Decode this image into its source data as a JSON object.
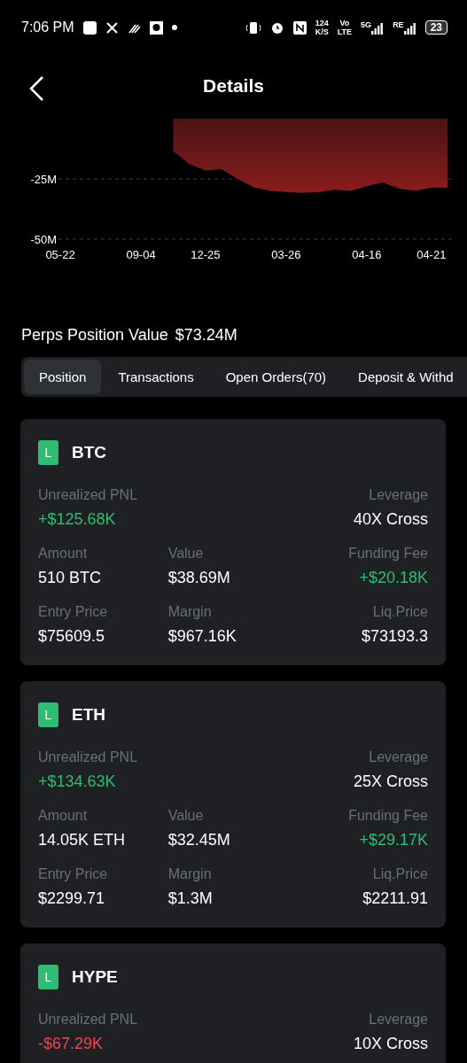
{
  "status_bar": {
    "time": "7:06 PM",
    "speed_value": "124",
    "speed_unit": "K/S",
    "volte_top": "Vo",
    "volte_bottom": "LTE",
    "network": "5G",
    "roaming": "RE",
    "battery": "23"
  },
  "header": {
    "title": "Details"
  },
  "chart": {
    "chart_data": {
      "type": "area",
      "categories": [
        "05-22",
        null,
        null,
        null,
        null,
        "09-04",
        null,
        null,
        null,
        "12-25",
        null,
        null,
        null,
        null,
        "03-26",
        null,
        null,
        null,
        null,
        "04-16",
        null,
        null,
        null,
        "04-21",
        null
      ],
      "series": [
        {
          "color": "#8a1c1c",
          "values": [
            null,
            null,
            null,
            null,
            null,
            null,
            null,
            -13.5,
            -18.8,
            -21.5,
            -21,
            -25,
            -28.5,
            -30,
            -30.4,
            -30.8,
            -30.5,
            -29.5,
            -30,
            -28,
            -26.5,
            -29,
            -30,
            -28.6,
            -28.7
          ]
        }
      ],
      "ylim": [
        -50,
        0
      ],
      "yticks": [
        {
          "value": -25,
          "label": "-25M"
        },
        {
          "value": -50,
          "label": "-50M"
        }
      ]
    }
  },
  "summary": {
    "label": "Perps Position Value",
    "value": "$73.24M"
  },
  "tabs": [
    {
      "label": "Position",
      "selected": true
    },
    {
      "label": "Transactions",
      "selected": false
    },
    {
      "label": "Open Orders(70)",
      "selected": false
    },
    {
      "label": "Deposit & Withd",
      "selected": false
    }
  ],
  "positions": [
    {
      "side": "L",
      "symbol": "BTC",
      "rows": [
        [
          {
            "label": "Unrealized PNL",
            "value": "+$125.68K",
            "kind": "gain"
          },
          null,
          {
            "label": "Leverage",
            "value": "40X Cross",
            "kind": "plain"
          }
        ],
        [
          {
            "label": "Amount",
            "value": "510 BTC",
            "kind": "plain"
          },
          {
            "label": "Value",
            "value": "$38.69M",
            "kind": "plain"
          },
          {
            "label": "Funding Fee",
            "value": "+$20.18K",
            "kind": "gain"
          }
        ],
        [
          {
            "label": "Entry Price",
            "value": "$75609.5",
            "kind": "plain"
          },
          {
            "label": "Margin",
            "value": "$967.16K",
            "kind": "plain"
          },
          {
            "label": "Liq.Price",
            "value": "$73193.3",
            "kind": "plain"
          }
        ]
      ]
    },
    {
      "side": "L",
      "symbol": "ETH",
      "rows": [
        [
          {
            "label": "Unrealized PNL",
            "value": "+$134.63K",
            "kind": "gain"
          },
          null,
          {
            "label": "Leverage",
            "value": "25X Cross",
            "kind": "plain"
          }
        ],
        [
          {
            "label": "Amount",
            "value": "14.05K ETH",
            "kind": "plain"
          },
          {
            "label": "Value",
            "value": "$32.45M",
            "kind": "plain"
          },
          {
            "label": "Funding Fee",
            "value": "+$29.17K",
            "kind": "gain"
          }
        ],
        [
          {
            "label": "Entry Price",
            "value": "$2299.71",
            "kind": "plain"
          },
          {
            "label": "Margin",
            "value": "$1.3M",
            "kind": "plain"
          },
          {
            "label": "Liq.Price",
            "value": "$2211.91",
            "kind": "plain"
          }
        ]
      ]
    },
    {
      "side": "L",
      "symbol": "HYPE",
      "rows": [
        [
          {
            "label": "Unrealized PNL",
            "value": "-$67.29K",
            "kind": "loss"
          },
          null,
          {
            "label": "Leverage",
            "value": "10X Cross",
            "kind": "plain"
          }
        ]
      ]
    }
  ]
}
